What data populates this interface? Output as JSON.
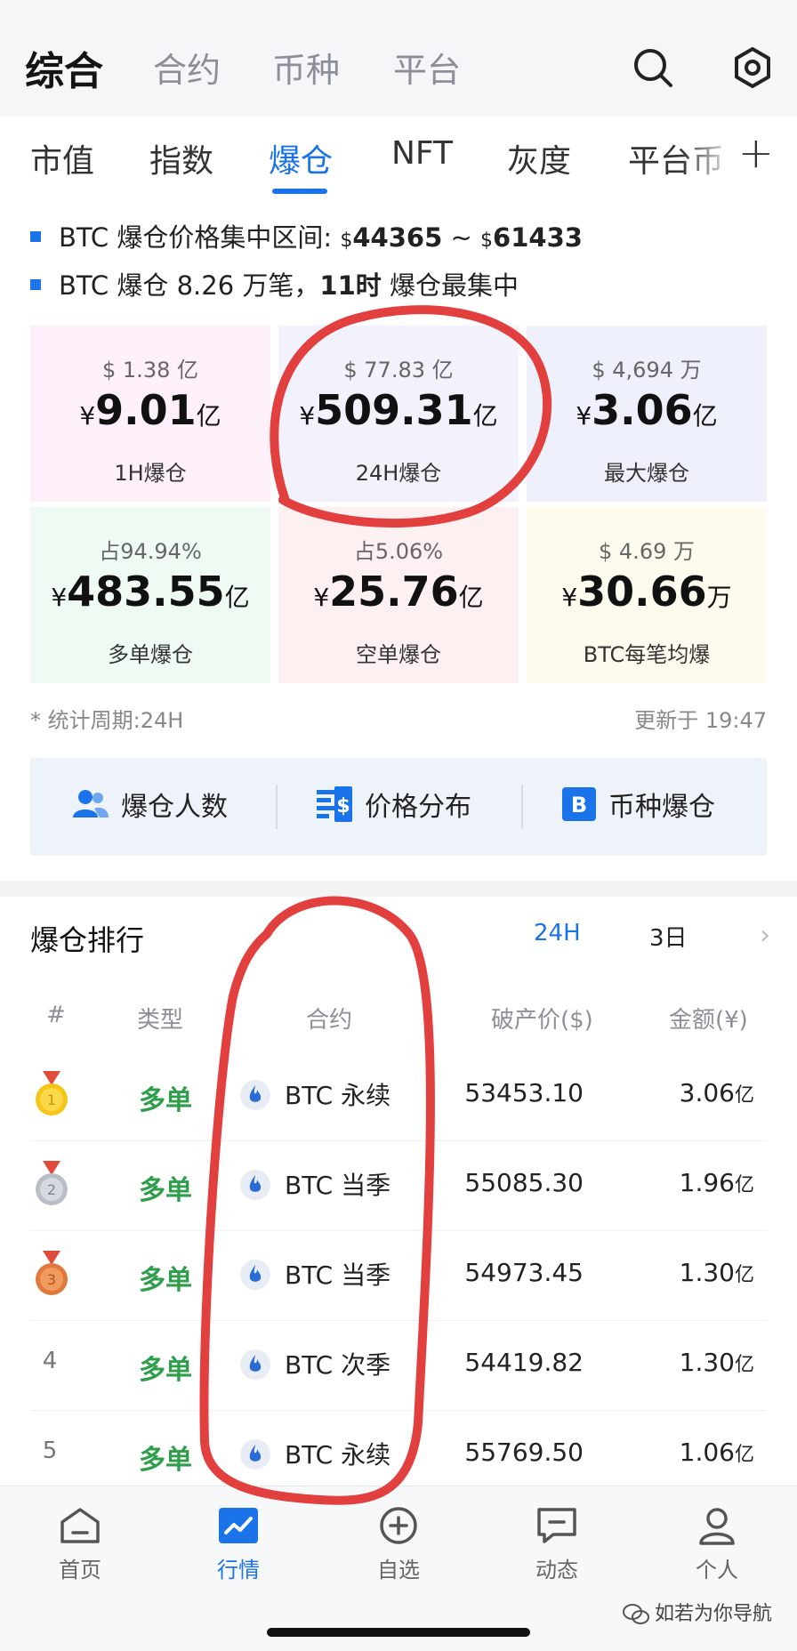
{
  "top_tabs": [
    "综合",
    "合约",
    "币种",
    "平台"
  ],
  "sub_tabs": [
    "市值",
    "指数",
    "爆仓",
    "NFT",
    "灰度",
    "平台币"
  ],
  "sub_plus": "+",
  "info": {
    "line1_prefix": "BTC 爆仓价格集中区间: ",
    "line1_cur1": "$",
    "line1_low": "44365",
    "line1_sep": " ~ ",
    "line1_cur2": "$",
    "line1_high": "61433",
    "line2_a": "BTC 爆仓 8.26 万笔，",
    "line2_b": "11时",
    "line2_c": " 爆仓最集中"
  },
  "cards": [
    {
      "top": "$ 1.38 亿",
      "cur": "¥",
      "value": "9.01",
      "unit": "亿",
      "label": "1H爆仓",
      "bg": "#fdf0fa"
    },
    {
      "top": "$ 77.83 亿",
      "cur": "¥",
      "value": "509.31",
      "unit": "亿",
      "label": "24H爆仓",
      "bg": "#f1f2fb"
    },
    {
      "top": "$ 4,694 万",
      "cur": "¥",
      "value": "3.06",
      "unit": "亿",
      "label": "最大爆仓",
      "bg": "#eef1fb"
    },
    {
      "top": "占94.94%",
      "cur": "¥",
      "value": "483.55",
      "unit": "亿",
      "label": "多单爆仓",
      "bg": "#effbf2"
    },
    {
      "top": "占5.06%",
      "cur": "¥",
      "value": "25.76",
      "unit": "亿",
      "label": "空单爆仓",
      "bg": "#fdf0f1"
    },
    {
      "top": "$ 4.69 万",
      "cur": "¥",
      "value": "30.66",
      "unit": "万",
      "label": "BTC每笔均爆",
      "bg": "#fefbee"
    }
  ],
  "footnote_left": "* 统计周期:24H",
  "footnote_right": "更新于 19:47",
  "quick_actions": [
    "爆仓人数",
    "价格分布",
    "币种爆仓"
  ],
  "ranking": {
    "title": "爆仓排行",
    "tabs": [
      "24H",
      "3日"
    ],
    "chevron": "›",
    "columns": [
      "#",
      "类型",
      "合约",
      "破产价($)",
      "金额(¥)"
    ],
    "rows": [
      {
        "rank": "1",
        "type": "多单",
        "contract": "BTC 永续",
        "price": "53453.10",
        "amount": "3.06",
        "unit": "亿"
      },
      {
        "rank": "2",
        "type": "多单",
        "contract": "BTC 当季",
        "price": "55085.30",
        "amount": "1.96",
        "unit": "亿"
      },
      {
        "rank": "3",
        "type": "多单",
        "contract": "BTC 当季",
        "price": "54973.45",
        "amount": "1.30",
        "unit": "亿"
      },
      {
        "rank": "4",
        "type": "多单",
        "contract": "BTC 次季",
        "price": "54419.82",
        "amount": "1.30",
        "unit": "亿"
      },
      {
        "rank": "5",
        "type": "多单",
        "contract": "BTC 永续",
        "price": "55769.50",
        "amount": "1.06",
        "unit": "亿"
      }
    ]
  },
  "tabbar": [
    "首页",
    "行情",
    "自选",
    "动态",
    "个人"
  ],
  "watermark": "如若为你导航",
  "colors": {
    "accent": "#1a73e8",
    "long": "#2e9e4a",
    "annotation": "#e2403f"
  }
}
